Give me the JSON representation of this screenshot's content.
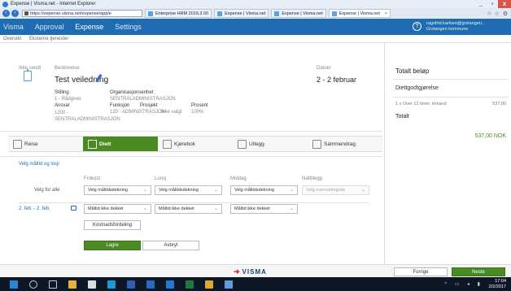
{
  "browser": {
    "window_title": "Expense | Visma.net - Internet Explorer",
    "address": "https://expense.visma.net/expense/app/e",
    "tabs": [
      {
        "label": "Enterprise HRM 2016.3.00"
      },
      {
        "label": "Expense | Visma.net"
      },
      {
        "label": "Expense | Visma.net"
      },
      {
        "label": "Expense | Visma.net",
        "active": true
      }
    ],
    "close_glyph": "×",
    "min_glyph": "_",
    "max_glyph": "▫",
    "close_win_glyph": "x"
  },
  "app": {
    "nav": [
      "Visma",
      "Approval",
      "Expense",
      "Settings"
    ],
    "active_nav": "Expense",
    "help": "?",
    "user_name": "ragnfrid.karlsen@grstangen...",
    "user_org": "Grstangen kommune"
  },
  "subnav": [
    "Oversikt",
    "Eksterne tjenester"
  ],
  "report": {
    "status": "Ikke sendt",
    "desc_label": "Beskrivelse",
    "title": "Test veiledning",
    "date_label": "Datoer",
    "dates": "2 - 2 februar",
    "stilling_label": "Stilling",
    "stilling_value": "1 - Rådgiver",
    "org_label": "Organisasjonsenhet",
    "org_value": "SENTRALADMINISTRASJON",
    "ansvar_label": "Ansvar",
    "ansvar_value": "1200 - SENTRALADMINISTRASJON",
    "funksjon_label": "Funksjon",
    "funksjon_value": "120 - ADMINISTRASJON",
    "prosjekt_label": "Prosjekt",
    "prosjekt_value": "Ikke valgt",
    "prosent_label": "Prosent",
    "prosent_value": "100%"
  },
  "steps": [
    {
      "label": "Reise",
      "icon": "travel-icon"
    },
    {
      "label": "Diett",
      "icon": "utensils-icon",
      "active": true
    },
    {
      "label": "Kjørebok",
      "icon": "car-log-icon"
    },
    {
      "label": "Utlegg",
      "icon": "receipt-icon"
    },
    {
      "label": "Sammendrag",
      "icon": "summary-icon"
    }
  ],
  "meals": {
    "section_link": "Velg måltid og losji",
    "col_frokost": "Frokost",
    "col_lunsj": "Lunsj",
    "col_middag": "Middag",
    "col_nattillegg": "Nattillegg",
    "row_all": "Velg for alle",
    "row_date": "2. feb. - 2. feb.",
    "sel_maaltid": "Velg måltidsdekning",
    "sel_overnatting": "Velg overnattingsde",
    "sel_ikke": "Måltid ikke dekket",
    "chevron": "⌄",
    "btn_kostnad": "Kostnadsfordeling",
    "btn_lagre": "Lagre",
    "btn_avbryt": "Avbryt"
  },
  "sidebar": {
    "title": "Totalt beløp",
    "subtitle": "Diettgodtgjørelse",
    "line": "1 x Over 12 timer, innland",
    "line_amount": "537,00",
    "total_label": "Totalt",
    "total_amount": "537,00 NOK"
  },
  "footer": {
    "logo": "VISMA",
    "prev": "Forrige",
    "next": "Neste"
  },
  "taskbar": {
    "time": "17:04",
    "date": "2/2/2017"
  }
}
